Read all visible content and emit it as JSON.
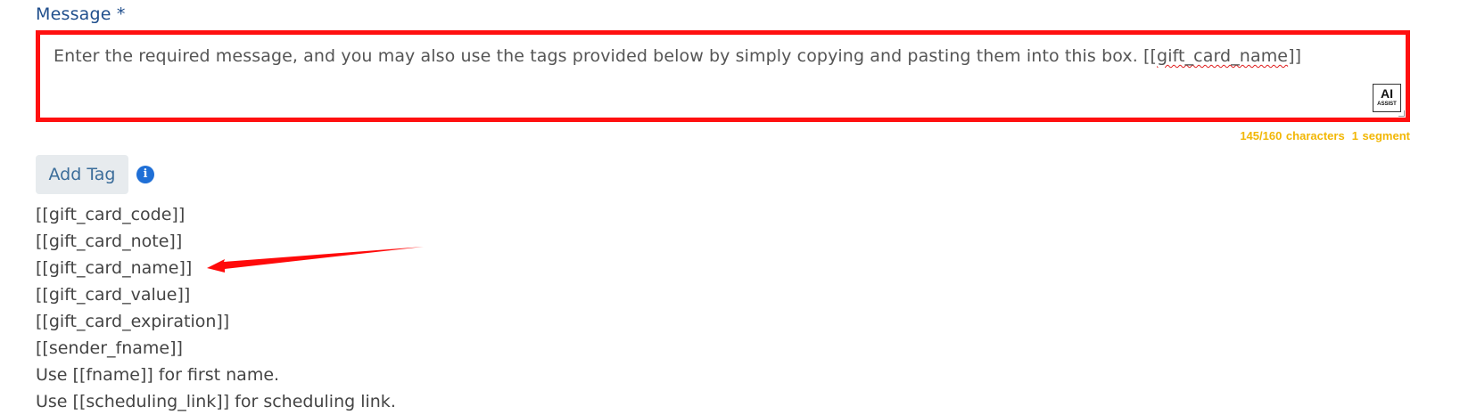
{
  "form": {
    "message_label": "Message *",
    "message_text_before": "Enter the required message, and you may also use the tags provided below by simply copying and pasting them into this box. [[",
    "message_text_misspelled": "gift_card_name",
    "message_text_after": "]]",
    "ai_assist": {
      "big": "AI",
      "small": "ASSIST"
    },
    "char_count": "145/160 characters",
    "segments": "1 segment",
    "add_tag_label": "Add Tag",
    "info_icon_glyph": "i"
  },
  "tags": [
    "[[gift_card_code]]",
    "[[gift_card_note]]",
    "[[gift_card_name]]",
    "[[gift_card_value]]",
    "[[gift_card_expiration]]",
    "[[sender_fname]]",
    "Use [[fname]] for first name.",
    "Use [[scheduling_link]] for scheduling link."
  ],
  "colors": {
    "highlight": "#ff1010",
    "label": "#1f4e8c",
    "counter": "#f2b705",
    "info": "#1f6fd6",
    "button_bg": "#e7ebee"
  }
}
